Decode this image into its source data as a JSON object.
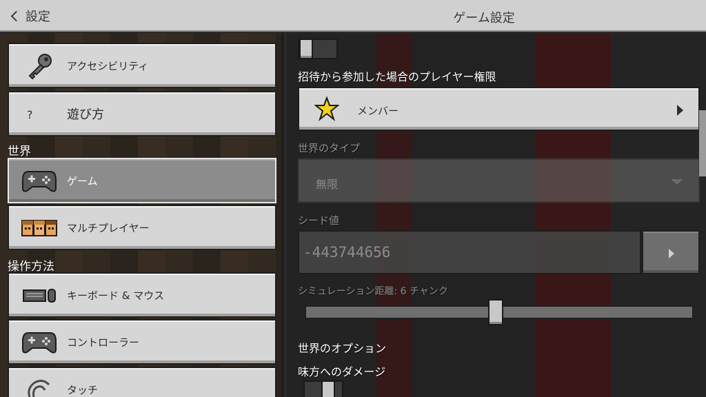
{
  "header": {
    "back_label": "設定",
    "title": "ゲーム設定"
  },
  "sidebar": {
    "items_top": [
      {
        "label": "アクセシビリティ",
        "icon": "key-icon"
      },
      {
        "label": "遊び方",
        "icon": "question-icon",
        "icon_glyph": "?"
      }
    ],
    "section_world": "世界",
    "items_world": [
      {
        "label": "ゲーム",
        "icon": "controller-icon",
        "active": true
      },
      {
        "label": "マルチプレイヤー",
        "icon": "players-icon"
      }
    ],
    "section_controls": "操作方法",
    "items_controls": [
      {
        "label": "キーボード & マウス",
        "icon": "keyboard-mouse-icon"
      },
      {
        "label": "コントローラー",
        "icon": "controller-icon"
      },
      {
        "label": "タッチ",
        "icon": "touch-icon"
      }
    ]
  },
  "settings": {
    "invite_permission_label": "招待から参加した場合のプレイヤー権限",
    "invite_permission_value": "メンバー",
    "world_type_label": "世界のタイプ",
    "world_type_value": "無限",
    "seed_label": "シード値",
    "seed_value": "-443744656",
    "simulation_label": "シミュレーション距離: 6 チャンク",
    "simulation_fraction": 0.49,
    "world_options_heading": "世界のオプション",
    "friendly_fire_label": "味方へのダメージ"
  },
  "colors": {
    "button_bg": "#d6d6d6",
    "button_active": "#8c8c8c",
    "topbar": "#d0d0d0",
    "star": "#f2d21a"
  }
}
